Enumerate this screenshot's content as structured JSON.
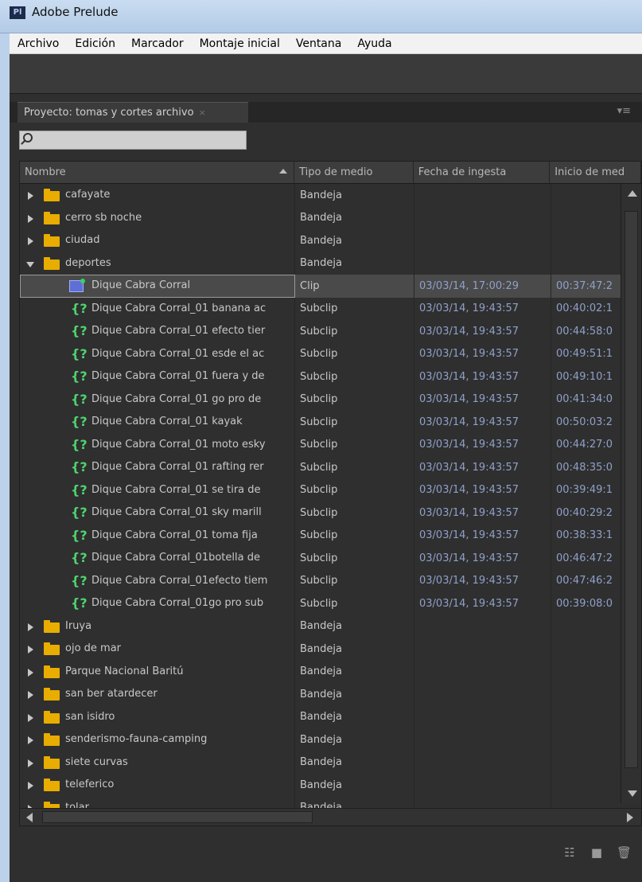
{
  "window": {
    "title": "Adobe Prelude",
    "logo": "Pl"
  },
  "menu": [
    "Archivo",
    "Edición",
    "Marcador",
    "Montaje inicial",
    "Ventana",
    "Ayuda"
  ],
  "panel": {
    "tab_label": "Proyecto: tomas y cortes archivo",
    "close_glyph": "×",
    "menu_glyph": "▾≡",
    "search_value": ""
  },
  "columns": [
    "Nombre",
    "Tipo de medio",
    "Fecha de ingesta",
    "Inicio de med"
  ],
  "rows": [
    {
      "kind": "folder",
      "expanded": false,
      "name": "cafayate",
      "type": "Bandeja",
      "date": "",
      "start": ""
    },
    {
      "kind": "folder",
      "expanded": false,
      "name": "cerro sb noche",
      "type": "Bandeja",
      "date": "",
      "start": ""
    },
    {
      "kind": "folder",
      "expanded": false,
      "name": "ciudad",
      "type": "Bandeja",
      "date": "",
      "start": ""
    },
    {
      "kind": "folder",
      "expanded": true,
      "name": "deportes",
      "type": "Bandeja",
      "date": "",
      "start": ""
    },
    {
      "kind": "clip",
      "name": "Dique Cabra Corral",
      "type": "Clip",
      "date": "03/03/14, 17:00:29",
      "start": "00:37:47:2",
      "selected": true
    },
    {
      "kind": "subclip",
      "name": "Dique Cabra Corral_01 banana ac",
      "type": "Subclip",
      "date": "03/03/14, 19:43:57",
      "start": "00:40:02:1"
    },
    {
      "kind": "subclip",
      "name": "Dique Cabra Corral_01 efecto tier",
      "type": "Subclip",
      "date": "03/03/14, 19:43:57",
      "start": "00:44:58:0"
    },
    {
      "kind": "subclip",
      "name": "Dique Cabra Corral_01 esde el ac",
      "type": "Subclip",
      "date": "03/03/14, 19:43:57",
      "start": "00:49:51:1"
    },
    {
      "kind": "subclip",
      "name": "Dique Cabra Corral_01 fuera y de",
      "type": "Subclip",
      "date": "03/03/14, 19:43:57",
      "start": "00:49:10:1"
    },
    {
      "kind": "subclip",
      "name": "Dique Cabra Corral_01 go pro de",
      "type": "Subclip",
      "date": "03/03/14, 19:43:57",
      "start": "00:41:34:0"
    },
    {
      "kind": "subclip",
      "name": "Dique Cabra Corral_01 kayak",
      "type": "Subclip",
      "date": "03/03/14, 19:43:57",
      "start": "00:50:03:2"
    },
    {
      "kind": "subclip",
      "name": "Dique Cabra Corral_01 moto esky",
      "type": "Subclip",
      "date": "03/03/14, 19:43:57",
      "start": "00:44:27:0"
    },
    {
      "kind": "subclip",
      "name": "Dique Cabra Corral_01 rafting rer",
      "type": "Subclip",
      "date": "03/03/14, 19:43:57",
      "start": "00:48:35:0"
    },
    {
      "kind": "subclip",
      "name": "Dique Cabra Corral_01 se tira de",
      "type": "Subclip",
      "date": "03/03/14, 19:43:57",
      "start": "00:39:49:1"
    },
    {
      "kind": "subclip",
      "name": "Dique Cabra Corral_01 sky marill",
      "type": "Subclip",
      "date": "03/03/14, 19:43:57",
      "start": "00:40:29:2"
    },
    {
      "kind": "subclip",
      "name": "Dique Cabra Corral_01 toma fija",
      "type": "Subclip",
      "date": "03/03/14, 19:43:57",
      "start": "00:38:33:1"
    },
    {
      "kind": "subclip",
      "name": "Dique Cabra Corral_01botella de",
      "type": "Subclip",
      "date": "03/03/14, 19:43:57",
      "start": "00:46:47:2"
    },
    {
      "kind": "subclip",
      "name": "Dique Cabra Corral_01efecto tiem",
      "type": "Subclip",
      "date": "03/03/14, 19:43:57",
      "start": "00:47:46:2"
    },
    {
      "kind": "subclip",
      "name": "Dique Cabra Corral_01go pro sub",
      "type": "Subclip",
      "date": "03/03/14, 19:43:57",
      "start": "00:39:08:0"
    },
    {
      "kind": "folder",
      "expanded": false,
      "name": "Iruya",
      "type": "Bandeja",
      "date": "",
      "start": ""
    },
    {
      "kind": "folder",
      "expanded": false,
      "name": "ojo de mar",
      "type": "Bandeja",
      "date": "",
      "start": ""
    },
    {
      "kind": "folder",
      "expanded": false,
      "name": "Parque Nacional Baritú",
      "type": "Bandeja",
      "date": "",
      "start": ""
    },
    {
      "kind": "folder",
      "expanded": false,
      "name": "san ber atardecer",
      "type": "Bandeja",
      "date": "",
      "start": ""
    },
    {
      "kind": "folder",
      "expanded": false,
      "name": "san isidro",
      "type": "Bandeja",
      "date": "",
      "start": ""
    },
    {
      "kind": "folder",
      "expanded": false,
      "name": "senderismo-fauna-camping",
      "type": "Bandeja",
      "date": "",
      "start": ""
    },
    {
      "kind": "folder",
      "expanded": false,
      "name": "siete curvas",
      "type": "Bandeja",
      "date": "",
      "start": ""
    },
    {
      "kind": "folder",
      "expanded": false,
      "name": "teleferico",
      "type": "Bandeja",
      "date": "",
      "start": ""
    },
    {
      "kind": "folder",
      "expanded": false,
      "name": "tolar",
      "type": "Bandeja",
      "date": "",
      "start": ""
    }
  ],
  "footer": {
    "icons": [
      "list-view-icon",
      "new-bin-icon",
      "trash-icon"
    ]
  }
}
